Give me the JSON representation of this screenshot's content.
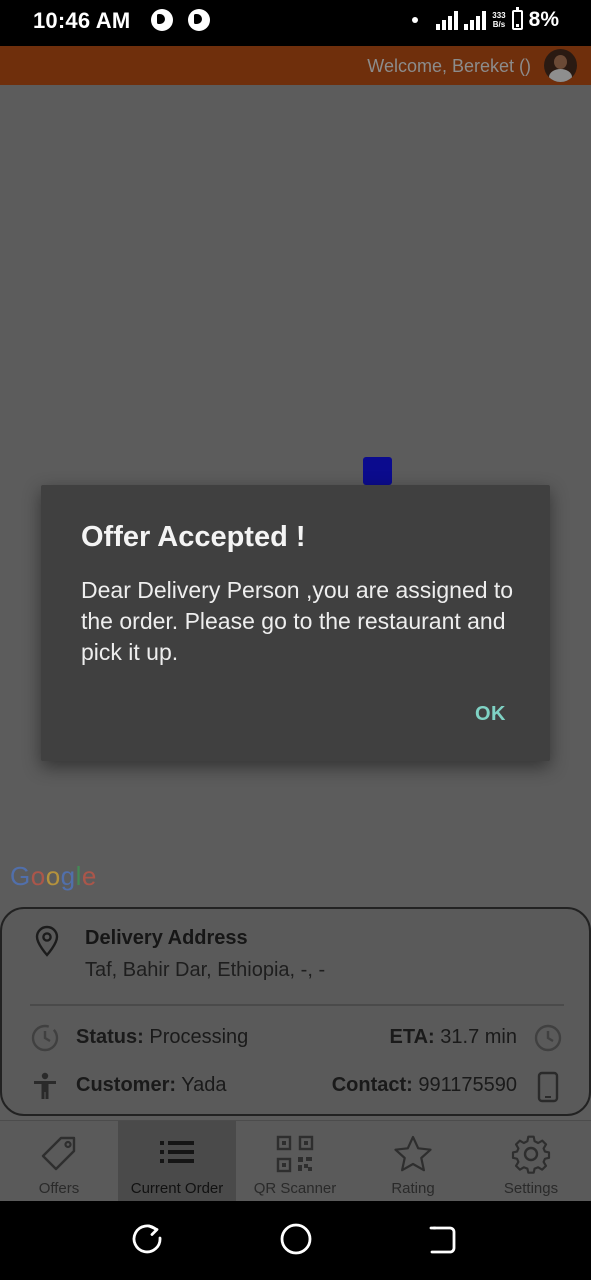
{
  "status_bar": {
    "time": "10:46 AM",
    "net_speed_value": "333",
    "net_speed_unit": "B/s",
    "battery": "8%"
  },
  "app_bar": {
    "welcome": "Welcome, Bereket ()"
  },
  "map": {
    "attribution": "Google",
    "marker_color": "#0b0b8e"
  },
  "order_card": {
    "address_title": "Delivery Address",
    "address_value": "Taf, Bahir Dar, Ethiopia, -, -",
    "status_label": "Status:",
    "status_value": "Processing",
    "eta_label": "ETA:",
    "eta_value": "31.7 min",
    "customer_label": "Customer:",
    "customer_value": "Yada",
    "contact_label": "Contact:",
    "contact_value": "991175590"
  },
  "bottom_nav": {
    "items": [
      {
        "label": "Offers",
        "icon": "tag-icon"
      },
      {
        "label": "Current Order",
        "icon": "list-icon",
        "active": true
      },
      {
        "label": "QR Scanner",
        "icon": "qr-code-icon"
      },
      {
        "label": "Rating",
        "icon": "star-icon"
      },
      {
        "label": "Settings",
        "icon": "gear-icon"
      }
    ]
  },
  "dialog": {
    "title": "Offer Accepted !",
    "message": "Dear Delivery Person ,you are assigned to the order. Please go to the restaurant and pick it up.",
    "ok_label": "OK",
    "ok_color": "#7fd2c4"
  },
  "colors": {
    "app_bar": "#6f2f0c",
    "overlay_map": "#5c5c5c",
    "dialog_bg": "#404040"
  }
}
